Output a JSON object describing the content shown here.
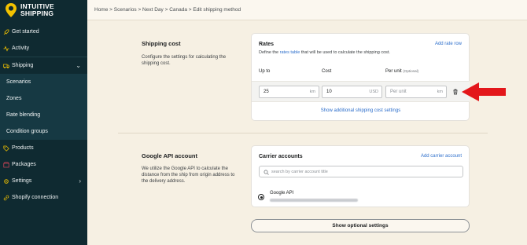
{
  "brand": {
    "line1": "INTUITIVE",
    "line2": "SHIPPING"
  },
  "breadcrumb": "Home > Scenarios > Next Day > Canada > Edit shipping method",
  "nav": [
    {
      "label": "Get started",
      "icon": "rocket-icon"
    },
    {
      "label": "Activity",
      "icon": "activity-icon"
    },
    {
      "label": "Shipping",
      "icon": "truck-icon"
    },
    {
      "label": "Scenarios"
    },
    {
      "label": "Zones"
    },
    {
      "label": "Rate blending"
    },
    {
      "label": "Condition groups"
    },
    {
      "label": "Products",
      "icon": "tag-icon"
    },
    {
      "label": "Packages",
      "icon": "package-icon"
    },
    {
      "label": "Settings",
      "icon": "gear-icon"
    },
    {
      "label": "Shopify connection",
      "icon": "link-icon"
    }
  ],
  "shipping_cost": {
    "title": "Shipping cost",
    "desc": "Configure the settings for calculating the shipping cost.",
    "rates": {
      "title": "Rates",
      "add_link": "Add rate row",
      "define_prefix": "Define the ",
      "define_link": "rates table",
      "define_suffix": " that will be used to calculate the shipping cost.",
      "col_upto": "Up to",
      "col_cost": "Cost",
      "col_perunit": "Per unit",
      "col_optional": "(Optional)",
      "row": {
        "upto": "25",
        "upto_unit": "km",
        "cost": "10",
        "cost_unit": "USD",
        "perunit_placeholder": "Per unit",
        "perunit_unit": "km"
      },
      "show_additional": "Show additional shipping cost settings"
    }
  },
  "google": {
    "title": "Google API account",
    "desc": "We utilize the Google API to calculate the distance from the ship from origin address to the delivery address.",
    "carrier": {
      "title": "Carrier accounts",
      "add_link": "Add carrier account",
      "search_placeholder": "search by carrier account title",
      "account_name": "Google API"
    }
  },
  "optional_button": "Show optional settings",
  "colors": {
    "sidebar": "#0f2a31",
    "accent_yellow": "#f2c200",
    "link": "#2c6ecb",
    "arrow": "#e3171b",
    "page_bg": "#f6f0e3"
  }
}
